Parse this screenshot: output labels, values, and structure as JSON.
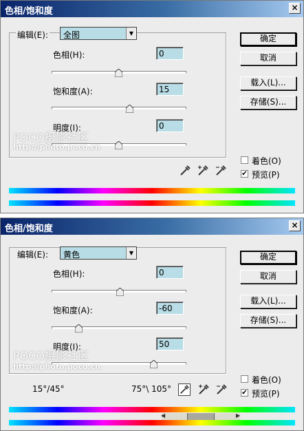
{
  "dialogs": [
    {
      "title": "色相/饱和度",
      "close_label": "×",
      "edit_label": "编辑(E):",
      "edit_value": "全图",
      "hue_label": "色相(H):",
      "hue_value": "0",
      "hue_slider_fraction": 0.5,
      "sat_label": "饱和度(A):",
      "sat_value": "15",
      "sat_slider_fraction": 0.575,
      "light_label": "明度(I):",
      "light_value": "0",
      "light_slider_fraction": 0.5,
      "buttons": {
        "ok": "确定",
        "cancel": "取消",
        "load": "载入(L)...",
        "save": "存储(S)..."
      },
      "colorize_label": "着色(O)",
      "colorize_checked": false,
      "preview_label": "预览(P)",
      "preview_checked": true
    },
    {
      "title": "色相/饱和度",
      "close_label": "×",
      "edit_label": "编辑(E):",
      "edit_value": "黄色",
      "hue_label": "色相(H):",
      "hue_value": "0",
      "hue_slider_fraction": 0.5,
      "sat_label": "饱和度(A):",
      "sat_value": "-60",
      "sat_slider_fraction": 0.2,
      "light_label": "明度(I):",
      "light_value": "50",
      "light_slider_fraction": 0.75,
      "range_left": "15°/45°",
      "range_right": "75°\\ 105°",
      "buttons": {
        "ok": "确定",
        "cancel": "取消",
        "load": "载入(L)...",
        "save": "存储(S)..."
      },
      "colorize_label": "着色(O)",
      "colorize_checked": false,
      "preview_label": "预览(P)",
      "preview_checked": true
    }
  ],
  "watermark": {
    "brand": "POCO摄影社区",
    "url": "http://photo.poco.cn"
  },
  "icons": [
    "close-icon",
    "dropdown-arrow-icon",
    "eyedropper-icon",
    "eyedropper-plus-icon",
    "eyedropper-minus-icon",
    "slider-thumb-icon",
    "checkmark-icon"
  ],
  "colors": {
    "title_bar": "#0a246a",
    "field_bg": "#b9dde6",
    "dialog_bg": "#ececec"
  }
}
